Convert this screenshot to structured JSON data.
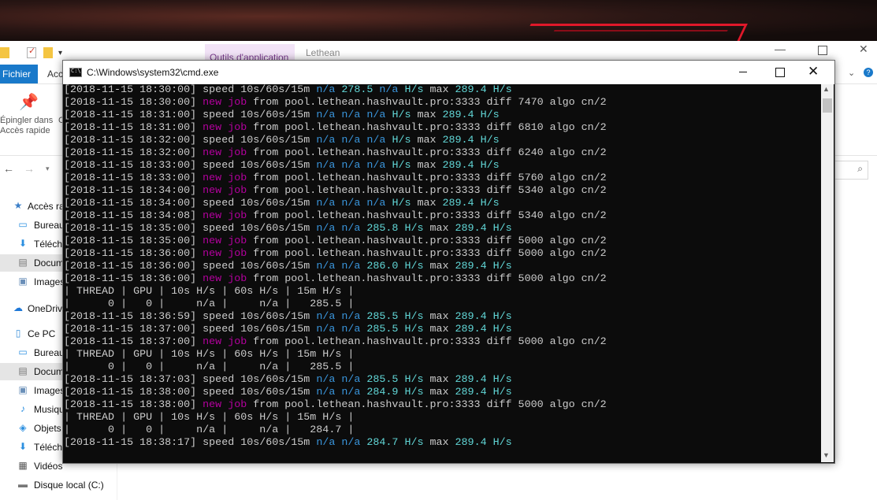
{
  "explorer": {
    "app_tools_tab": "Outils d'application",
    "window_title": "Lethean",
    "file_tab": "Fichier",
    "access_tab": "Acc",
    "pin_label_1": "Épingler dans",
    "pin_label_2": "Accès rapide",
    "ribbon_c": "C",
    "nav_items": [
      {
        "label": "Accès ra",
        "icon": "star-icon"
      },
      {
        "label": "Bureau",
        "icon": "desktop-icon"
      },
      {
        "label": "Télécha",
        "icon": "download-icon"
      },
      {
        "label": "Docum",
        "icon": "document-icon"
      },
      {
        "label": "Images",
        "icon": "images-icon"
      },
      {
        "label": "OneDriv",
        "icon": "cloud-icon"
      },
      {
        "label": "Ce PC",
        "icon": "computer-icon"
      },
      {
        "label": "Bureau",
        "icon": "desktop-icon"
      },
      {
        "label": "Docum",
        "icon": "document-icon"
      },
      {
        "label": "Images",
        "icon": "images-icon"
      },
      {
        "label": "Musiqu",
        "icon": "music-icon"
      },
      {
        "label": "Objets",
        "icon": "objects-icon"
      },
      {
        "label": "Télécha",
        "icon": "download-icon"
      },
      {
        "label": "Vidéos",
        "icon": "video-icon"
      },
      {
        "label": "Disque local (C:)",
        "icon": "drive-icon"
      }
    ]
  },
  "cmd": {
    "title": "C:\\Windows\\system32\\cmd.exe",
    "lines": [
      {
        "t": "speed",
        "ts": "2018-11-15 18:30:00",
        "v1": "n/a",
        "v2": "278.5",
        "v3": "n/a",
        "max": "289.4"
      },
      {
        "t": "job",
        "ts": "2018-11-15 18:30:00",
        "pool": "pool.lethean.hashvault.pro:3333",
        "diff": "7470",
        "algo": "cn/2"
      },
      {
        "t": "speed",
        "ts": "2018-11-15 18:31:00",
        "v1": "n/a",
        "v2": "n/a",
        "v3": "n/a",
        "max": "289.4"
      },
      {
        "t": "job",
        "ts": "2018-11-15 18:31:00",
        "pool": "pool.lethean.hashvault.pro:3333",
        "diff": "6810",
        "algo": "cn/2"
      },
      {
        "t": "speed",
        "ts": "2018-11-15 18:32:00",
        "v1": "n/a",
        "v2": "n/a",
        "v3": "n/a",
        "max": "289.4"
      },
      {
        "t": "job",
        "ts": "2018-11-15 18:32:00",
        "pool": "pool.lethean.hashvault.pro:3333",
        "diff": "6240",
        "algo": "cn/2"
      },
      {
        "t": "speed",
        "ts": "2018-11-15 18:33:00",
        "v1": "n/a",
        "v2": "n/a",
        "v3": "n/a",
        "max": "289.4"
      },
      {
        "t": "job",
        "ts": "2018-11-15 18:33:00",
        "pool": "pool.lethean.hashvault.pro:3333",
        "diff": "5760",
        "algo": "cn/2"
      },
      {
        "t": "job",
        "ts": "2018-11-15 18:34:00",
        "pool": "pool.lethean.hashvault.pro:3333",
        "diff": "5340",
        "algo": "cn/2"
      },
      {
        "t": "speed",
        "ts": "2018-11-15 18:34:00",
        "v1": "n/a",
        "v2": "n/a",
        "v3": "n/a",
        "max": "289.4"
      },
      {
        "t": "job",
        "ts": "2018-11-15 18:34:08",
        "pool": "pool.lethean.hashvault.pro:3333",
        "diff": "5340",
        "algo": "cn/2"
      },
      {
        "t": "speed",
        "ts": "2018-11-15 18:35:00",
        "v1": "n/a",
        "v2": "n/a",
        "v3": "285.8",
        "max": "289.4"
      },
      {
        "t": "job",
        "ts": "2018-11-15 18:35:00",
        "pool": "pool.lethean.hashvault.pro:3333",
        "diff": "5000",
        "algo": "cn/2"
      },
      {
        "t": "job",
        "ts": "2018-11-15 18:36:00",
        "pool": "pool.lethean.hashvault.pro:3333",
        "diff": "5000",
        "algo": "cn/2"
      },
      {
        "t": "speed",
        "ts": "2018-11-15 18:36:00",
        "v1": "n/a",
        "v2": "n/a",
        "v3": "286.0",
        "max": "289.4"
      },
      {
        "t": "job",
        "ts": "2018-11-15 18:36:00",
        "pool": "pool.lethean.hashvault.pro:3333",
        "diff": "5000",
        "algo": "cn/2"
      },
      {
        "t": "plain",
        "text": "| THREAD | GPU | 10s H/s | 60s H/s | 15m H/s |"
      },
      {
        "t": "plain",
        "text": "|      0 |   0 |     n/a |     n/a |   285.5 |"
      },
      {
        "t": "speed",
        "ts": "2018-11-15 18:36:59",
        "v1": "n/a",
        "v2": "n/a",
        "v3": "285.5",
        "max": "289.4"
      },
      {
        "t": "speed",
        "ts": "2018-11-15 18:37:00",
        "v1": "n/a",
        "v2": "n/a",
        "v3": "285.5",
        "max": "289.4"
      },
      {
        "t": "job",
        "ts": "2018-11-15 18:37:00",
        "pool": "pool.lethean.hashvault.pro:3333",
        "diff": "5000",
        "algo": "cn/2"
      },
      {
        "t": "plain",
        "text": "| THREAD | GPU | 10s H/s | 60s H/s | 15m H/s |"
      },
      {
        "t": "plain",
        "text": "|      0 |   0 |     n/a |     n/a |   285.5 |"
      },
      {
        "t": "speed",
        "ts": "2018-11-15 18:37:03",
        "v1": "n/a",
        "v2": "n/a",
        "v3": "285.5",
        "max": "289.4"
      },
      {
        "t": "speed",
        "ts": "2018-11-15 18:38:00",
        "v1": "n/a",
        "v2": "n/a",
        "v3": "284.9",
        "max": "289.4"
      },
      {
        "t": "job",
        "ts": "2018-11-15 18:38:00",
        "pool": "pool.lethean.hashvault.pro:3333",
        "diff": "5000",
        "algo": "cn/2"
      },
      {
        "t": "plain",
        "text": "| THREAD | GPU | 10s H/s | 60s H/s | 15m H/s |"
      },
      {
        "t": "plain",
        "text": "|      0 |   0 |     n/a |     n/a |   284.7 |"
      },
      {
        "t": "speed",
        "ts": "2018-11-15 18:38:17",
        "v1": "n/a",
        "v2": "n/a",
        "v3": "284.7",
        "max": "289.4"
      }
    ]
  }
}
